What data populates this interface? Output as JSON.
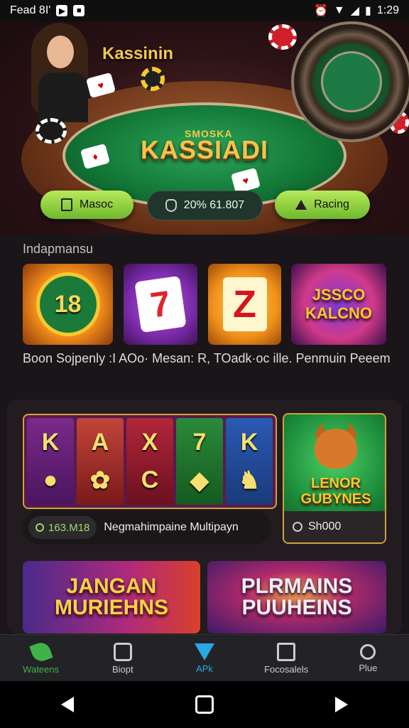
{
  "status_bar": {
    "time": "Fead 8I'",
    "clock": "1:29"
  },
  "hero": {
    "brand": "Kassinin",
    "table_sub": "SMOSKA",
    "table_title": "KASSIADI",
    "buttons": [
      {
        "label": "Masoc",
        "icon": "square-icon"
      },
      {
        "label": "20% 61.807",
        "icon": "shield-icon"
      },
      {
        "label": "Racing",
        "icon": "house-icon"
      }
    ]
  },
  "section1": {
    "title": "Indapmansu",
    "tiles": [
      {
        "text": "18",
        "icon": "badge-icon"
      },
      {
        "text": "7",
        "icon": "card-icon"
      },
      {
        "text": "Z",
        "icon": "card-icon"
      },
      {
        "text": "JSSCO KALCNO"
      }
    ],
    "description": "Boon Sojpenly :I AOo· Mesan: R, TOadk·oc ille. Penmuin Peeem"
  },
  "section2": {
    "reels": [
      {
        "top": "K",
        "bottom": "●"
      },
      {
        "top": "A",
        "bottom": "✿"
      },
      {
        "top": "X",
        "bottom": "C"
      },
      {
        "top": "7",
        "bottom": "◆"
      },
      {
        "top": "K",
        "bottom": "♞"
      }
    ],
    "slot_badge": "163.M18",
    "slot_title": "Negmahimpaine Multipayn",
    "fox_title": "LENOR GUBYNES",
    "fox_amount": "Sh000"
  },
  "promos": [
    {
      "title": "JANGAN MURIEHNS"
    },
    {
      "title": "PLRMAINS PUUHEINS"
    }
  ],
  "nav": [
    {
      "label": "Wateens",
      "icon": "leaf-icon"
    },
    {
      "label": "Biopt",
      "icon": "dice-icon"
    },
    {
      "label": "APk",
      "icon": "gem-icon"
    },
    {
      "label": "Focosalels",
      "icon": "check-icon"
    },
    {
      "label": "Plue",
      "icon": "person-icon"
    }
  ]
}
